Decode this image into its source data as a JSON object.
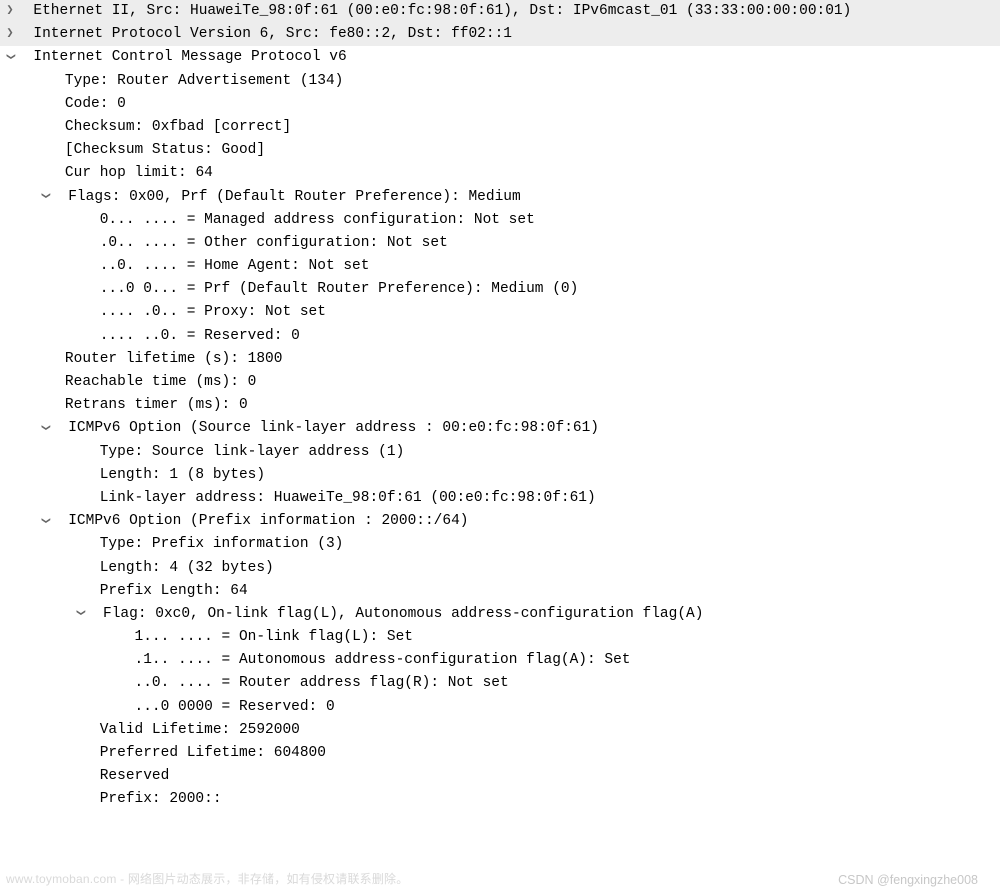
{
  "lines": {
    "eth": "Ethernet II, Src: HuaweiTe_98:0f:61 (00:e0:fc:98:0f:61), Dst: IPv6mcast_01 (33:33:00:00:00:01)",
    "ipv6": "Internet Protocol Version 6, Src: fe80::2, Dst: ff02::1",
    "icmpv6": "Internet Control Message Protocol v6",
    "type": "Type: Router Advertisement (134)",
    "code": "Code: 0",
    "checksum": "Checksum: 0xfbad [correct]",
    "checksum_status": "[Checksum Status: Good]",
    "hop": "Cur hop limit: 64",
    "flags_hdr": "Flags: 0x00, Prf (Default Router Preference): Medium",
    "flag_m": "0... .... = Managed address configuration: Not set",
    "flag_o": ".0.. .... = Other configuration: Not set",
    "flag_h": "..0. .... = Home Agent: Not set",
    "flag_prf": "...0 0... = Prf (Default Router Preference): Medium (0)",
    "flag_px": ".... .0.. = Proxy: Not set",
    "flag_r": ".... ..0. = Reserved: 0",
    "router_life": "Router lifetime (s): 1800",
    "reach": "Reachable time (ms): 0",
    "retrans": "Retrans timer (ms): 0",
    "opt1_hdr": "ICMPv6 Option (Source link-layer address : 00:e0:fc:98:0f:61)",
    "opt1_type": "Type: Source link-layer address (1)",
    "opt1_len": "Length: 1 (8 bytes)",
    "opt1_addr": "Link-layer address: HuaweiTe_98:0f:61 (00:e0:fc:98:0f:61)",
    "opt2_hdr": "ICMPv6 Option (Prefix information : 2000::/64)",
    "opt2_type": "Type: Prefix information (3)",
    "opt2_len": "Length: 4 (32 bytes)",
    "opt2_plen": "Prefix Length: 64",
    "opt2_flag_hdr": "Flag: 0xc0, On-link flag(L), Autonomous address-configuration flag(A)",
    "opt2_flag_l": "1... .... = On-link flag(L): Set",
    "opt2_flag_a": ".1.. .... = Autonomous address-configuration flag(A): Set",
    "opt2_flag_r": "..0. .... = Router address flag(R): Not set",
    "opt2_flag_res": "...0 0000 = Reserved: 0",
    "opt2_valid": "Valid Lifetime: 2592000",
    "opt2_pref": "Preferred Lifetime: 604800",
    "opt2_res": "Reserved",
    "opt2_prefix": "Prefix: 2000::"
  },
  "watermark": {
    "left": "www.toymoban.com - 网络图片动态展示，非存储，如有侵权请联系删除。",
    "right": "CSDN @fengxingzhe008"
  },
  "glyphs": {
    "right": "❯",
    "down": "❯"
  }
}
